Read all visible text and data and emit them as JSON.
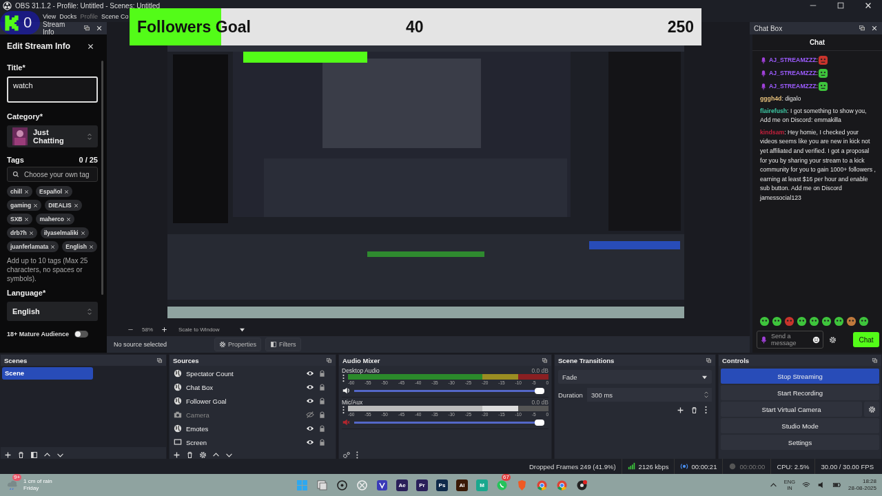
{
  "window": {
    "title": "OBS 31.1.2 - Profile: Untitled - Scenes: Untitled"
  },
  "menu": [
    {
      "label": "View",
      "disabled": false
    },
    {
      "label": "Docks",
      "disabled": false
    },
    {
      "label": "Profile",
      "disabled": true
    },
    {
      "label": "Scene Co",
      "disabled": false
    }
  ],
  "overlays": {
    "spectator_count": "0",
    "follower_goal": {
      "title": "Followers Goal",
      "current": "40",
      "target": "250",
      "level": 0.16
    }
  },
  "stream_info_dock": {
    "title": "Stream Info",
    "heading": "Edit Stream Info",
    "title_label": "Title*",
    "title_value": "watch",
    "category_label": "Category*",
    "category": "Just Chatting",
    "tags_label": "Tags",
    "tags_count": "0 / 25",
    "tags_placeholder": "Choose your own tag",
    "tags": [
      "chill",
      "Español",
      "gaming",
      "DIEALIS",
      "SXB",
      "maherco",
      "drb7h",
      "ilyaselmaliki",
      "juanferlamata",
      "English"
    ],
    "tags_hint": "Add up to 10 tags (Max 25 characters, no spaces or symbols).",
    "language_label": "Language*",
    "language": "English",
    "mature_label": "18+ Mature Audience",
    "mature_on": false
  },
  "preview": {
    "kind": "picture",
    "zoom": "58%",
    "scale_mode": "Scale to Window"
  },
  "source_toolbar": {
    "status": "No source selected",
    "buttons": [
      {
        "label": "Properties",
        "kind": "properties"
      },
      {
        "label": "Filters",
        "kind": "filters"
      }
    ]
  },
  "chat_dock": {
    "title": "Chat Box",
    "heading": "Chat",
    "messages": [
      {
        "kind": "emote",
        "badge": true,
        "user": "AJ_STREAMZZZ",
        "color": "#9d5cff",
        "text": ":"
      },
      {
        "kind": "emote",
        "badge": true,
        "user": "AJ_STREAMZZZ",
        "color": "#9d5cff",
        "text": ":"
      },
      {
        "kind": "emote",
        "badge": true,
        "user": "AJ_STREAMZZZ",
        "color": "#9d5cff",
        "text": ":"
      },
      {
        "kind": "text",
        "badge": false,
        "user": "gggh4d",
        "color": "#e6c07b",
        "text": ": digalo"
      },
      {
        "kind": "text",
        "badge": false,
        "user": "flairefush",
        "color": "#3cc7a3",
        "text": ": I got something to show you, Add me on Discord: emmakilla"
      },
      {
        "kind": "text",
        "badge": false,
        "user": "kindsam",
        "color": "#c4203c",
        "text": ": Hey homie, I checked your videos seems like you are new in kick not yet affiliated and verified. I got a proposal for you by sharing your stream to a kick community for you to gain 1000+ followers , earning at least $16 per hour and enable sub button. Add me on Discord jamessocial123"
      }
    ],
    "input_placeholder": "Send a message",
    "send_button": "Chat"
  },
  "scenes": {
    "title": "Scenes",
    "items": [
      {
        "name": "Scene",
        "selected": true
      }
    ]
  },
  "sources": {
    "title": "Sources",
    "items": [
      {
        "name": "Spectator Count",
        "kind": "browser",
        "visible": true
      },
      {
        "name": "Chat Box",
        "kind": "browser",
        "visible": true
      },
      {
        "name": "Follower Goal",
        "kind": "browser",
        "visible": true
      },
      {
        "name": "Camera",
        "kind": "camera",
        "visible": false
      },
      {
        "name": "Emotes",
        "kind": "browser",
        "visible": true
      },
      {
        "name": "Screen",
        "kind": "display",
        "visible": true
      }
    ]
  },
  "audio_mixer": {
    "title": "Audio Mixer",
    "channels": [
      {
        "name": "Desktop Audio",
        "reading": "0.0 dB",
        "muted": false,
        "level": 1,
        "ticks": [
          "-60",
          "-55",
          "-50",
          "-45",
          "-40",
          "-35",
          "-30",
          "-25",
          "-20",
          "-15",
          "-10",
          "-5",
          "0"
        ]
      },
      {
        "name": "Mic/Aux",
        "reading": "0.0 dB",
        "muted": true,
        "level": 1,
        "ticks": [
          "-60",
          "-55",
          "-50",
          "-45",
          "-40",
          "-35",
          "-30",
          "-25",
          "-20",
          "-15",
          "-10",
          "-5",
          "0"
        ]
      }
    ]
  },
  "scene_transitions": {
    "title": "Scene Transitions",
    "transition": "Fade",
    "duration_label": "Duration",
    "duration": "300 ms"
  },
  "controls": {
    "title": "Controls",
    "buttons": [
      {
        "label": "Stop Streaming",
        "active": true,
        "settings": false
      },
      {
        "label": "Start Recording",
        "active": false,
        "settings": false
      },
      {
        "label": "Start Virtual Camera",
        "active": false,
        "settings": true
      },
      {
        "label": "Studio Mode",
        "active": false,
        "settings": false
      },
      {
        "label": "Settings",
        "active": false,
        "settings": false
      }
    ]
  },
  "status_bar": {
    "dropped_frames": "Dropped Frames 249 (41.9%)",
    "bitrate": "2126 kbps",
    "stream_time": "00:00:21",
    "record_time": "00:00:00",
    "cpu": "CPU: 2.5%",
    "fps": "30.00 / 30.00 FPS"
  },
  "taskbar": {
    "weather": "1 cm of rain",
    "day": "Friday",
    "weather_badge": "9+",
    "apps": [
      {
        "kind": "start"
      },
      {
        "kind": "taskview"
      },
      {
        "kind": "circle"
      },
      {
        "kind": "knot"
      },
      {
        "kind": "vector"
      },
      {
        "kind": "tile",
        "label": "Ae",
        "color": "#2a1f5a"
      },
      {
        "kind": "tile",
        "label": "Pr",
        "color": "#2a1f5a"
      },
      {
        "kind": "tile",
        "label": "Ps",
        "color": "#0f2a4a"
      },
      {
        "kind": "tile",
        "label": "Ai",
        "color": "#3a1a06"
      },
      {
        "kind": "tile",
        "label": "M",
        "color": "#1aa88e"
      },
      {
        "kind": "whatsapp",
        "badge": "67"
      },
      {
        "kind": "brave"
      },
      {
        "kind": "chrome"
      },
      {
        "kind": "chrome"
      },
      {
        "kind": "recorder"
      }
    ],
    "language": "ENG",
    "region": "IN",
    "time": "18:28",
    "date": "28-08-2025"
  }
}
